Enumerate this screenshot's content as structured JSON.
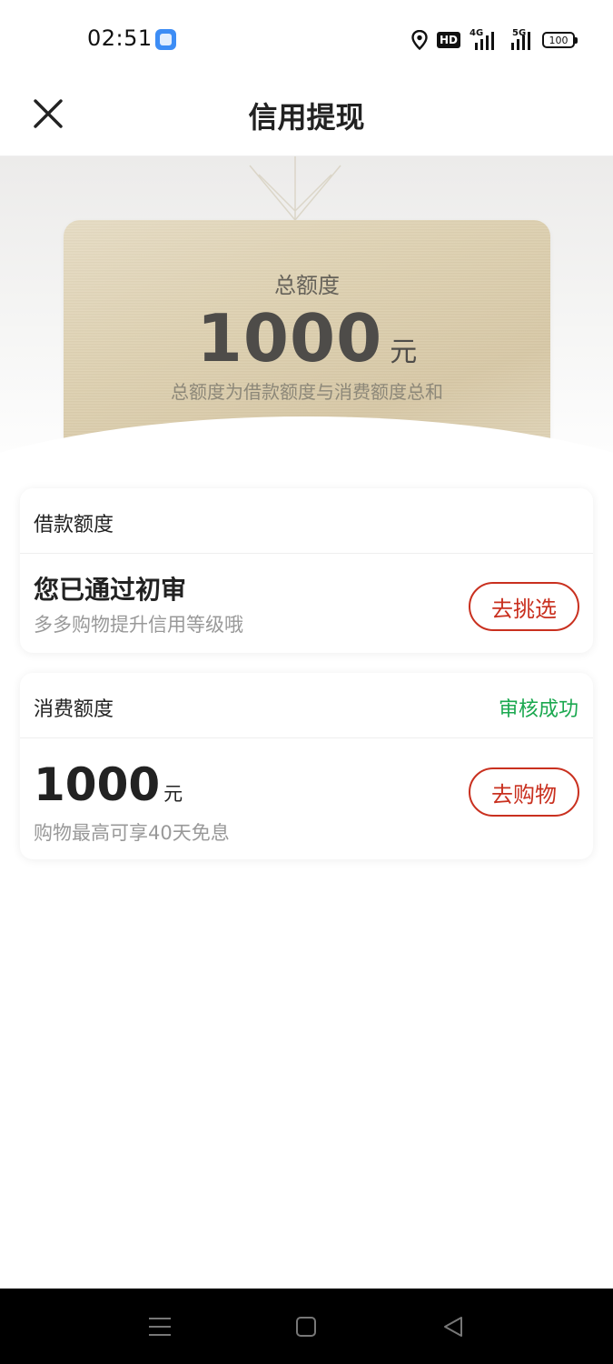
{
  "status_bar": {
    "time": "02:51",
    "signal1_label": "4G",
    "signal2_label": "5G",
    "battery": "100"
  },
  "header": {
    "title": "信用提现"
  },
  "banner": {
    "total_label": "总额度",
    "total_amount": "1000",
    "total_unit": "元",
    "note": "总额度为借款额度与消费额度总和"
  },
  "loan_card": {
    "title": "借款额度",
    "headline": "您已通过初审",
    "subtitle": "多多购物提升信用等级哦",
    "button": "去挑选"
  },
  "consumption_card": {
    "title": "消费额度",
    "status": "审核成功",
    "amount": "1000",
    "unit": "元",
    "subtitle": "购物最高可享40天免息",
    "button": "去购物"
  },
  "colors": {
    "accent_red": "#c9301f",
    "success_green": "#1aa84f",
    "card_gold": "#ddd0b0"
  }
}
